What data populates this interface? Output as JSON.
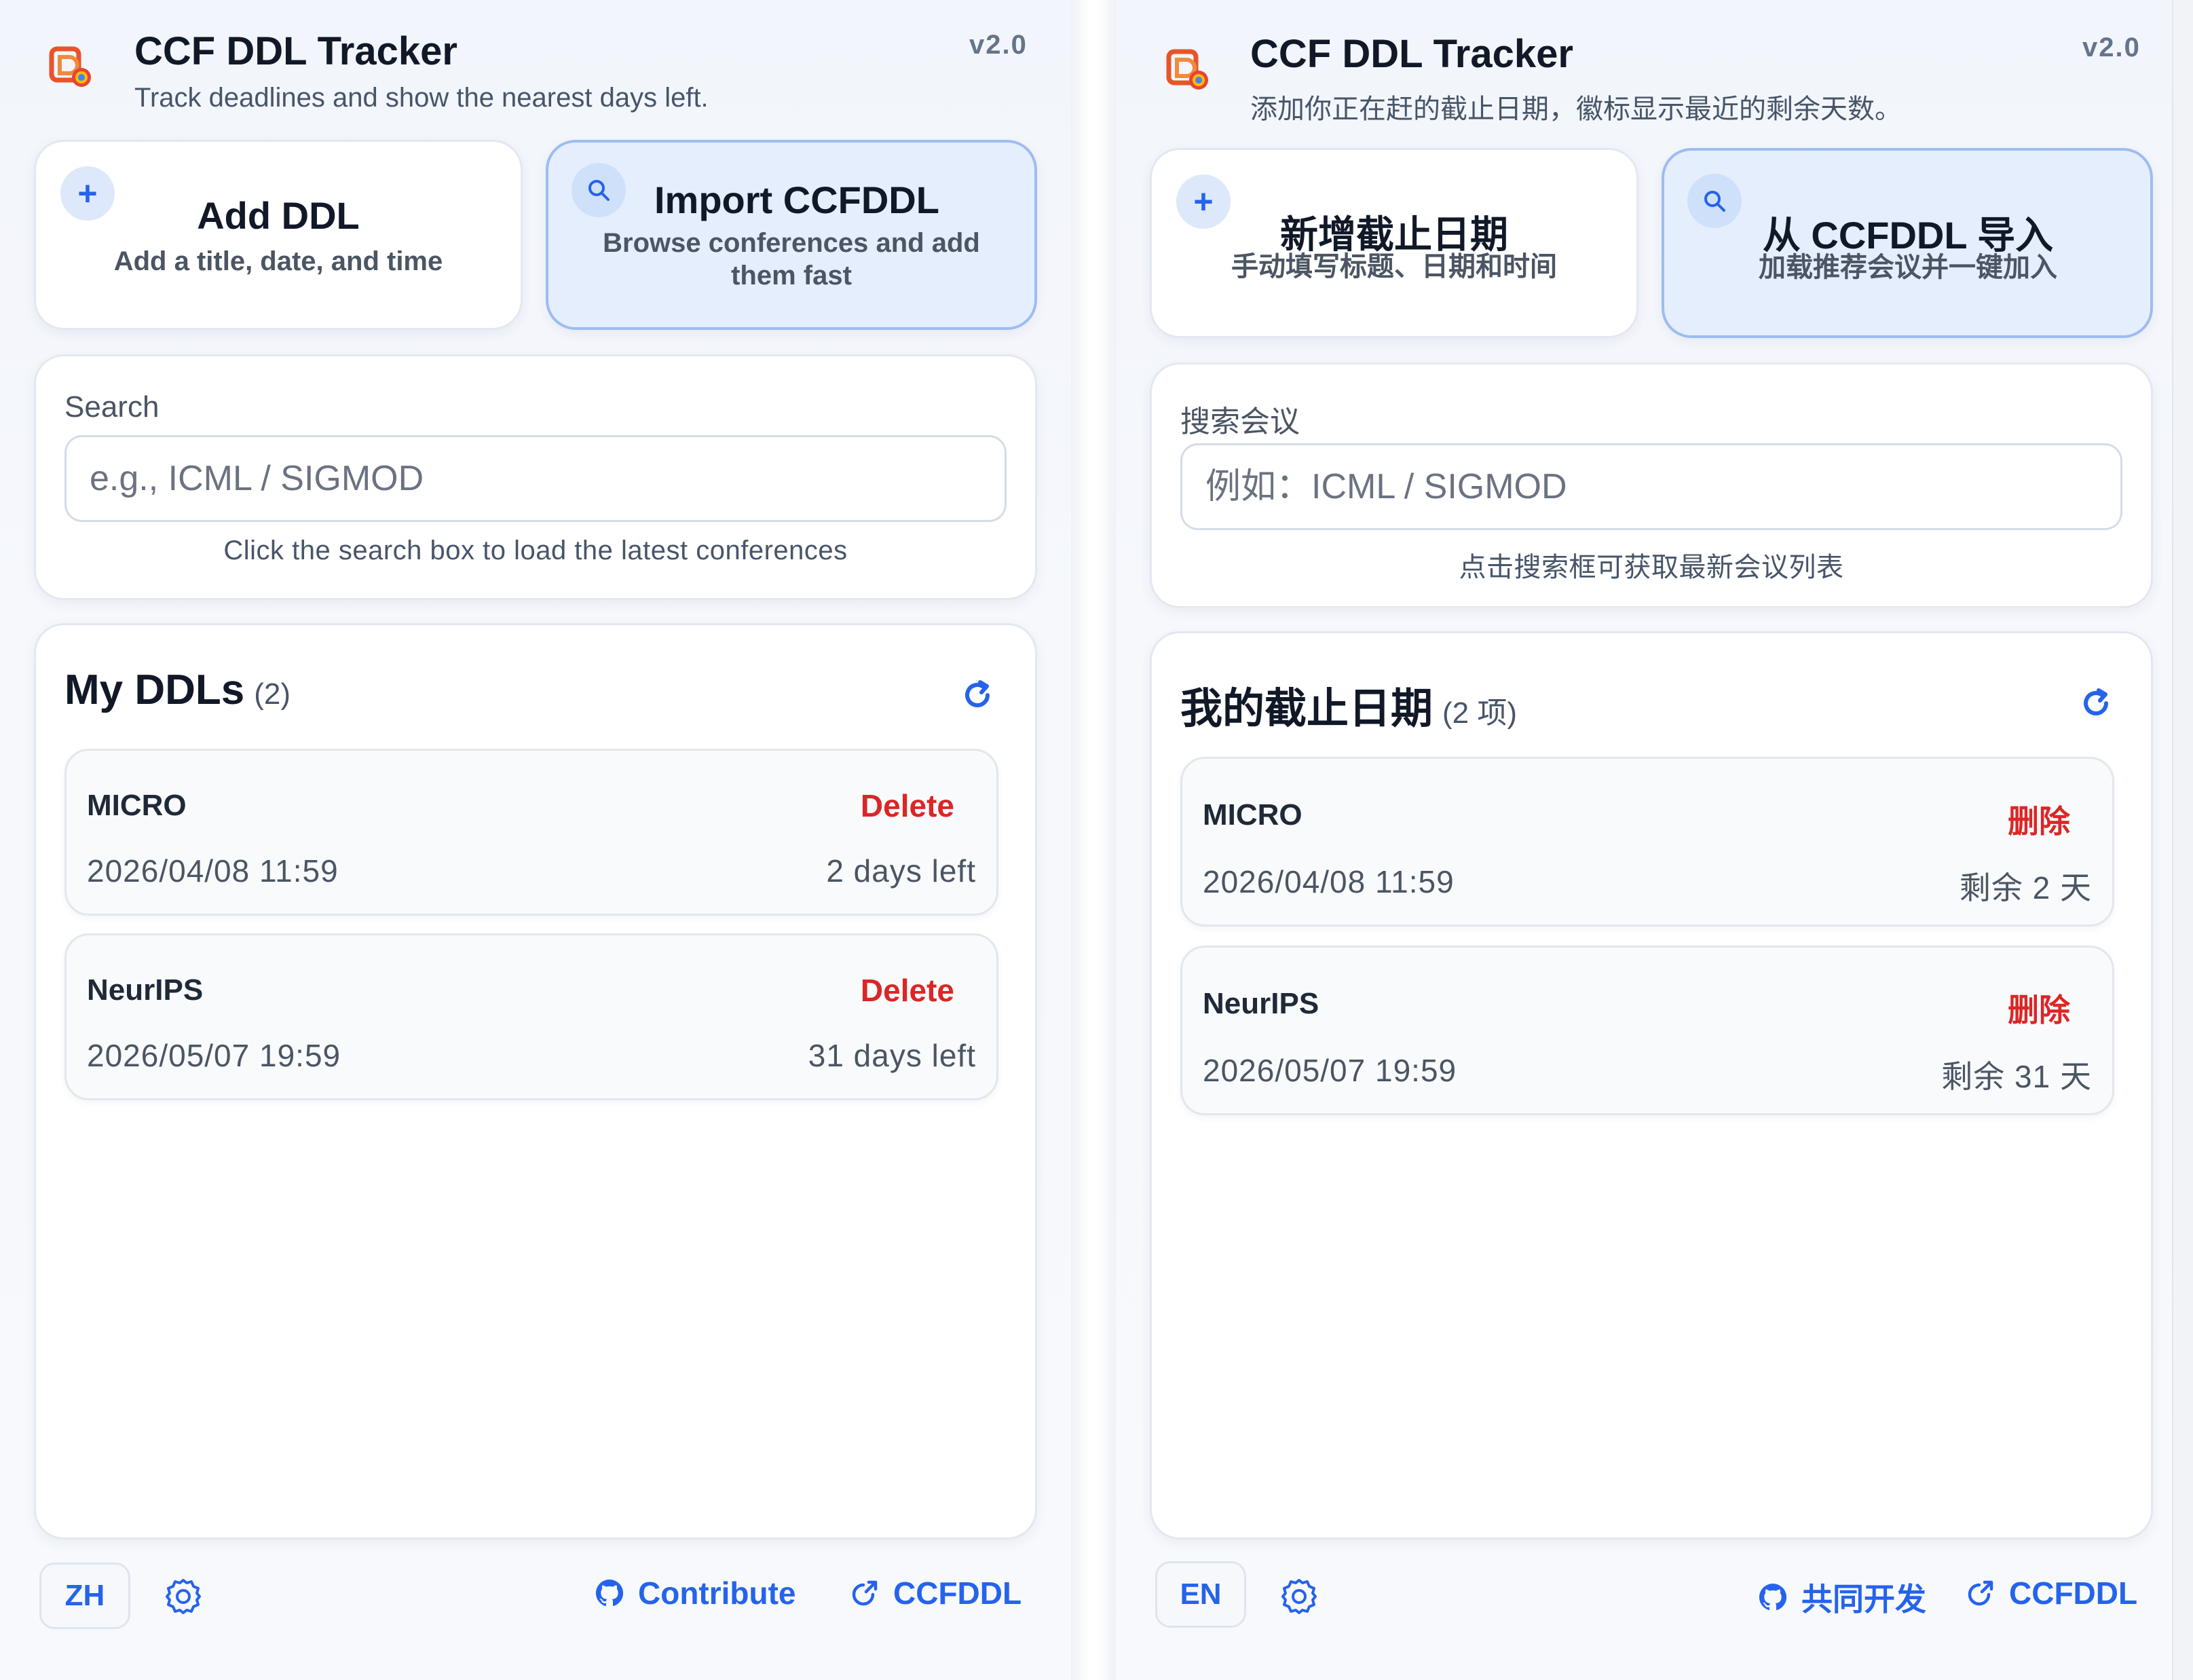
{
  "panels": {
    "en": {
      "app_title": "CCF DDL Tracker",
      "subtitle": "Track deadlines and show the nearest days left.",
      "version": "v2.0",
      "add": {
        "icon": "plus-icon",
        "title": "Add DDL",
        "sub": "Add a title, date, and time"
      },
      "import": {
        "icon": "search-icon",
        "title": "Import CCFDDL",
        "sub": "Browse conferences and add them fast"
      },
      "search": {
        "label": "Search",
        "placeholder": "e.g., ICML / SIGMOD",
        "hint": "Click the search box to load the latest conferences"
      },
      "list": {
        "title": "My DDLs",
        "count": "(2)"
      },
      "items": [
        {
          "name": "MICRO",
          "delete": "Delete",
          "date": "2026/04/08 11:59",
          "left": "2 days left"
        },
        {
          "name": "NeurIPS",
          "delete": "Delete",
          "date": "2026/05/07 19:59",
          "left": "31 days left"
        }
      ],
      "footer": {
        "lang": "ZH",
        "contribute": "Contribute",
        "ccfddl": "CCFDDL"
      }
    },
    "zh": {
      "app_title": "CCF DDL Tracker",
      "subtitle": "添加你正在赶的截止日期，徽标显示最近的剩余天数。",
      "version": "v2.0",
      "add": {
        "icon": "plus-icon",
        "title": "新增截止日期",
        "sub": "手动填写标题、日期和时间"
      },
      "import": {
        "icon": "search-icon",
        "title": "从 CCFDDL 导入",
        "sub": "加载推荐会议并一键加入"
      },
      "search": {
        "label": "搜索会议",
        "placeholder": "例如：ICML / SIGMOD",
        "hint": "点击搜索框可获取最新会议列表"
      },
      "list": {
        "title": "我的截止日期",
        "count": "(2 项)"
      },
      "items": [
        {
          "name": "MICRO",
          "delete": "删除",
          "date": "2026/04/08 11:59",
          "left": "剩余 2 天"
        },
        {
          "name": "NeurIPS",
          "delete": "删除",
          "date": "2026/05/07 19:59",
          "left": "剩余 31 天"
        }
      ],
      "footer": {
        "lang": "EN",
        "contribute": "共同开发",
        "ccfddl": "CCFDDL"
      }
    }
  },
  "icons": [
    "app-logo-icon",
    "plus-icon",
    "search-icon",
    "refresh-icon",
    "gear-icon",
    "github-icon",
    "external-link-icon"
  ],
  "colors": {
    "accent": "#2563eb",
    "danger": "#dc2626",
    "primary_card_bg": "#e4eefd",
    "primary_card_border": "#9dbcf1"
  }
}
